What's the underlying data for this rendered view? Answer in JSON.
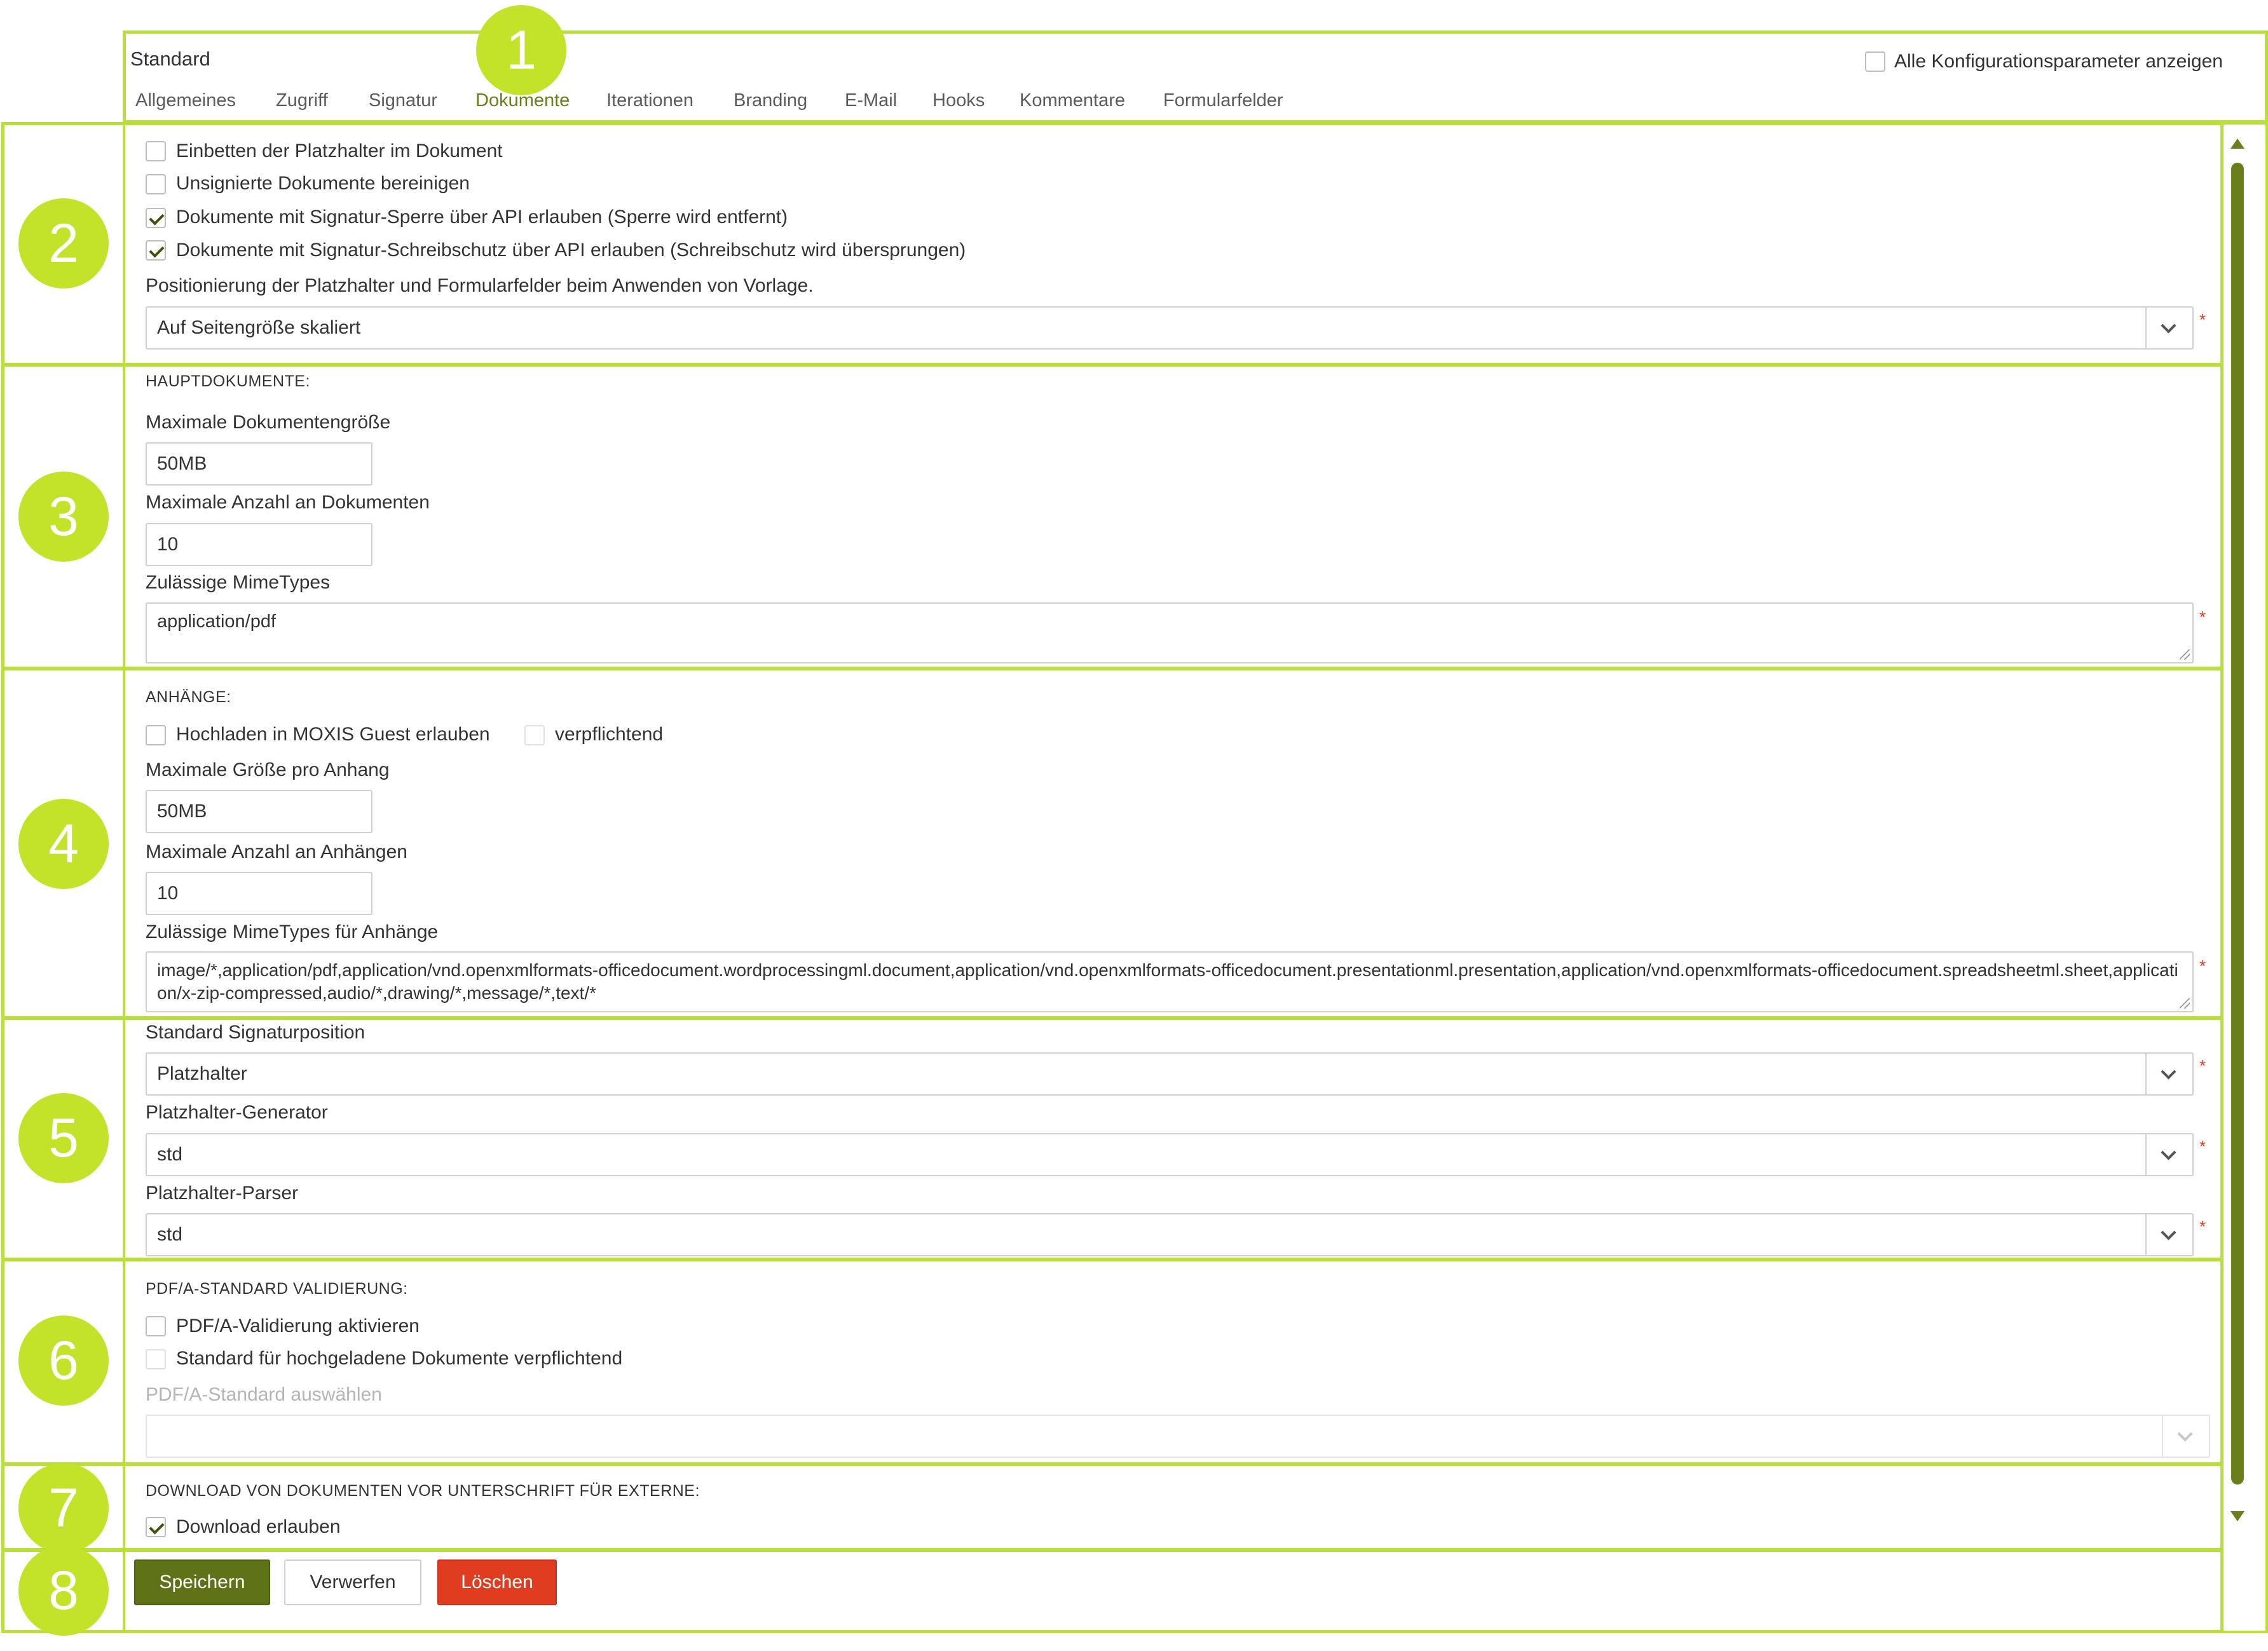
{
  "header": {
    "title": "Standard",
    "show_all_label": "Alle Konfigurationsparameter anzeigen",
    "tabs": [
      "Allgemeines",
      "Zugriff",
      "Signatur",
      "Dokumente",
      "Iterationen",
      "Branding",
      "E-Mail",
      "Hooks",
      "Kommentare",
      "Formularfelder"
    ],
    "active_tab": "Dokumente"
  },
  "badges": [
    "1",
    "2",
    "3",
    "4",
    "5",
    "6",
    "7",
    "8"
  ],
  "section2": {
    "cb1": "Einbetten der Platzhalter im Dokument",
    "cb2": "Unsignierte Dokumente bereinigen",
    "cb3": "Dokumente mit Signatur-Sperre über API erlauben (Sperre wird entfernt)",
    "cb4": "Dokumente mit Signatur-Schreibschutz über API erlauben (Schreibschutz wird übersprungen)",
    "positioning_label": "Positionierung der Platzhalter und Formularfelder beim Anwenden von Vorlage.",
    "positioning_value": "Auf Seitengröße skaliert"
  },
  "section3": {
    "heading": "HAUPTDOKUMENTE:",
    "max_size_label": "Maximale Dokumentengröße",
    "max_size_value": "50MB",
    "max_count_label": "Maximale Anzahl an Dokumenten",
    "max_count_value": "10",
    "mime_label": "Zulässige MimeTypes",
    "mime_value": "application/pdf"
  },
  "section4": {
    "heading": "ANHÄNGE:",
    "upload_label": "Hochladen in MOXIS Guest erlauben",
    "mandatory_label": "verpflichtend",
    "max_size_label": "Maximale Größe pro Anhang",
    "max_size_value": "50MB",
    "max_count_label": "Maximale Anzahl an Anhängen",
    "max_count_value": "10",
    "mime_label": "Zulässige MimeTypes für Anhänge",
    "mime_value": "image/*,application/pdf,application/vnd.openxmlformats-officedocument.wordprocessingml.document,application/vnd.openxmlformats-officedocument.presentationml.presentation,application/vnd.openxmlformats-officedocument.spreadsheetml.sheet,application/x-zip-compressed,audio/*,drawing/*,message/*,text/*"
  },
  "section5": {
    "sigpos_label": "Standard Signaturposition",
    "sigpos_value": "Platzhalter",
    "generator_label": "Platzhalter-Generator",
    "generator_value": "std",
    "parser_label": "Platzhalter-Parser",
    "parser_value": "std"
  },
  "section6": {
    "heading": "PDF/A-STANDARD VALIDIERUNG:",
    "activate_label": "PDF/A-Validierung aktivieren",
    "mandatory_label": "Standard für hochgeladene Dokumente verpflichtend",
    "select_label": "PDF/A-Standard auswählen",
    "select_value": ""
  },
  "section7": {
    "heading": "DOWNLOAD VON DOKUMENTEN VOR UNTERSCHRIFT FÜR EXTERNE:",
    "download_label": "Download erlauben"
  },
  "actions": {
    "save": "Speichern",
    "discard": "Verwerfen",
    "delete": "Löschen"
  },
  "required_mark": "*",
  "colors": {
    "accent": "#6b7e1c",
    "highlight": "#b9e03a",
    "badge": "#c3e32a",
    "danger": "#e03c1f"
  }
}
